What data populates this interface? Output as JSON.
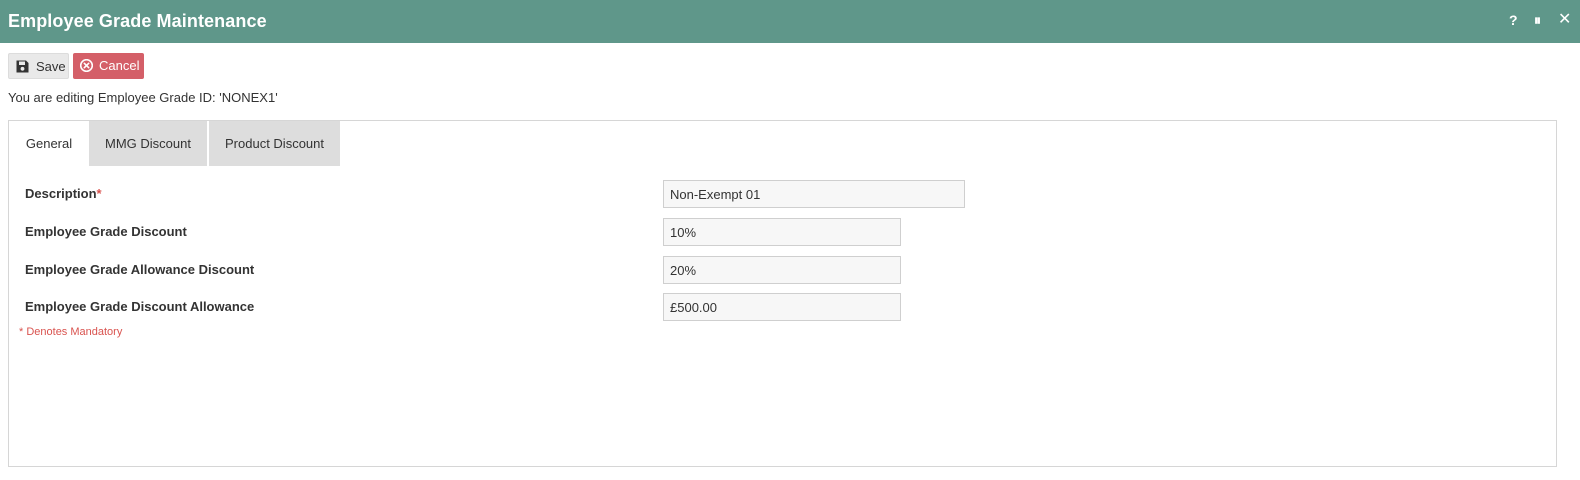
{
  "window": {
    "title": "Employee Grade Maintenance",
    "help_label": "?",
    "pause_label": "⏸",
    "close_label": "✕"
  },
  "toolbar": {
    "save_label": "Save",
    "cancel_label": "Cancel",
    "save_icon": "floppy-disk-icon",
    "cancel_icon": "x-circle-icon"
  },
  "edit_info": "You are editing Employee Grade ID: 'NONEX1'",
  "tabs": [
    {
      "label": "General",
      "active": true
    },
    {
      "label": "MMG Discount",
      "active": false
    },
    {
      "label": "Product Discount",
      "active": false
    }
  ],
  "form": {
    "description": {
      "label": "Description",
      "required_mark": "*",
      "value": "Non-Exempt 01"
    },
    "grade_discount": {
      "label": "Employee Grade Discount",
      "value": "10%"
    },
    "allowance_discount": {
      "label": "Employee Grade Allowance Discount",
      "value": "20%"
    },
    "discount_allowance": {
      "label": "Employee Grade Discount Allowance",
      "value": "£500.00"
    },
    "mandatory_note": "* Denotes Mandatory"
  },
  "colors": {
    "titlebar": "#5f978a",
    "cancel": "#d45f68",
    "required": "#d9534f"
  }
}
